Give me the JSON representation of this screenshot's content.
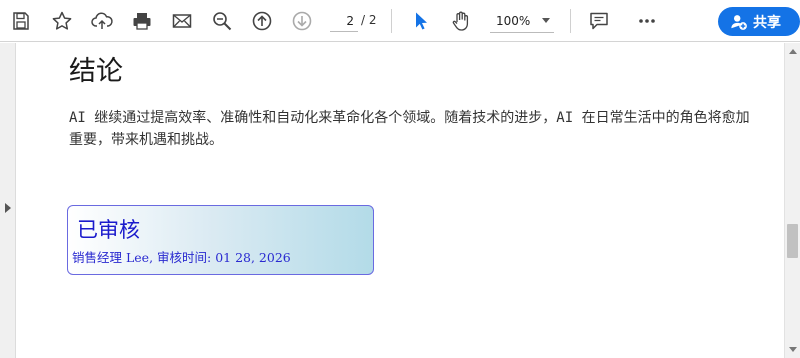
{
  "toolbar": {
    "icons": [
      "save-icon",
      "bookmark-star-icon",
      "cloud-upload-icon",
      "print-icon",
      "email-icon",
      "zoom-search-icon",
      "page-up-icon",
      "page-down-icon",
      "select-pointer-icon",
      "hand-tool-icon",
      "comment-icon",
      "more-icon"
    ],
    "page_current": "2",
    "page_total": "/ 2",
    "zoom": "100%",
    "share_label": "共享",
    "share_color": "#1473e6",
    "active_tool_color": "#1473e6"
  },
  "document": {
    "heading": "结论",
    "paragraph": "AI 继续通过提高效率、准确性和自动化来革命化各个领域。随着技术的进步，AI 在日常生活中的角色将愈加重要，带来机遇和挑战。"
  },
  "stamp": {
    "title": "已审核",
    "subtitle": "销售经理 Lee, 审核时间: 01 28, 2026",
    "border_color": "#6a6ae0",
    "text_color": "#1a1acc"
  }
}
